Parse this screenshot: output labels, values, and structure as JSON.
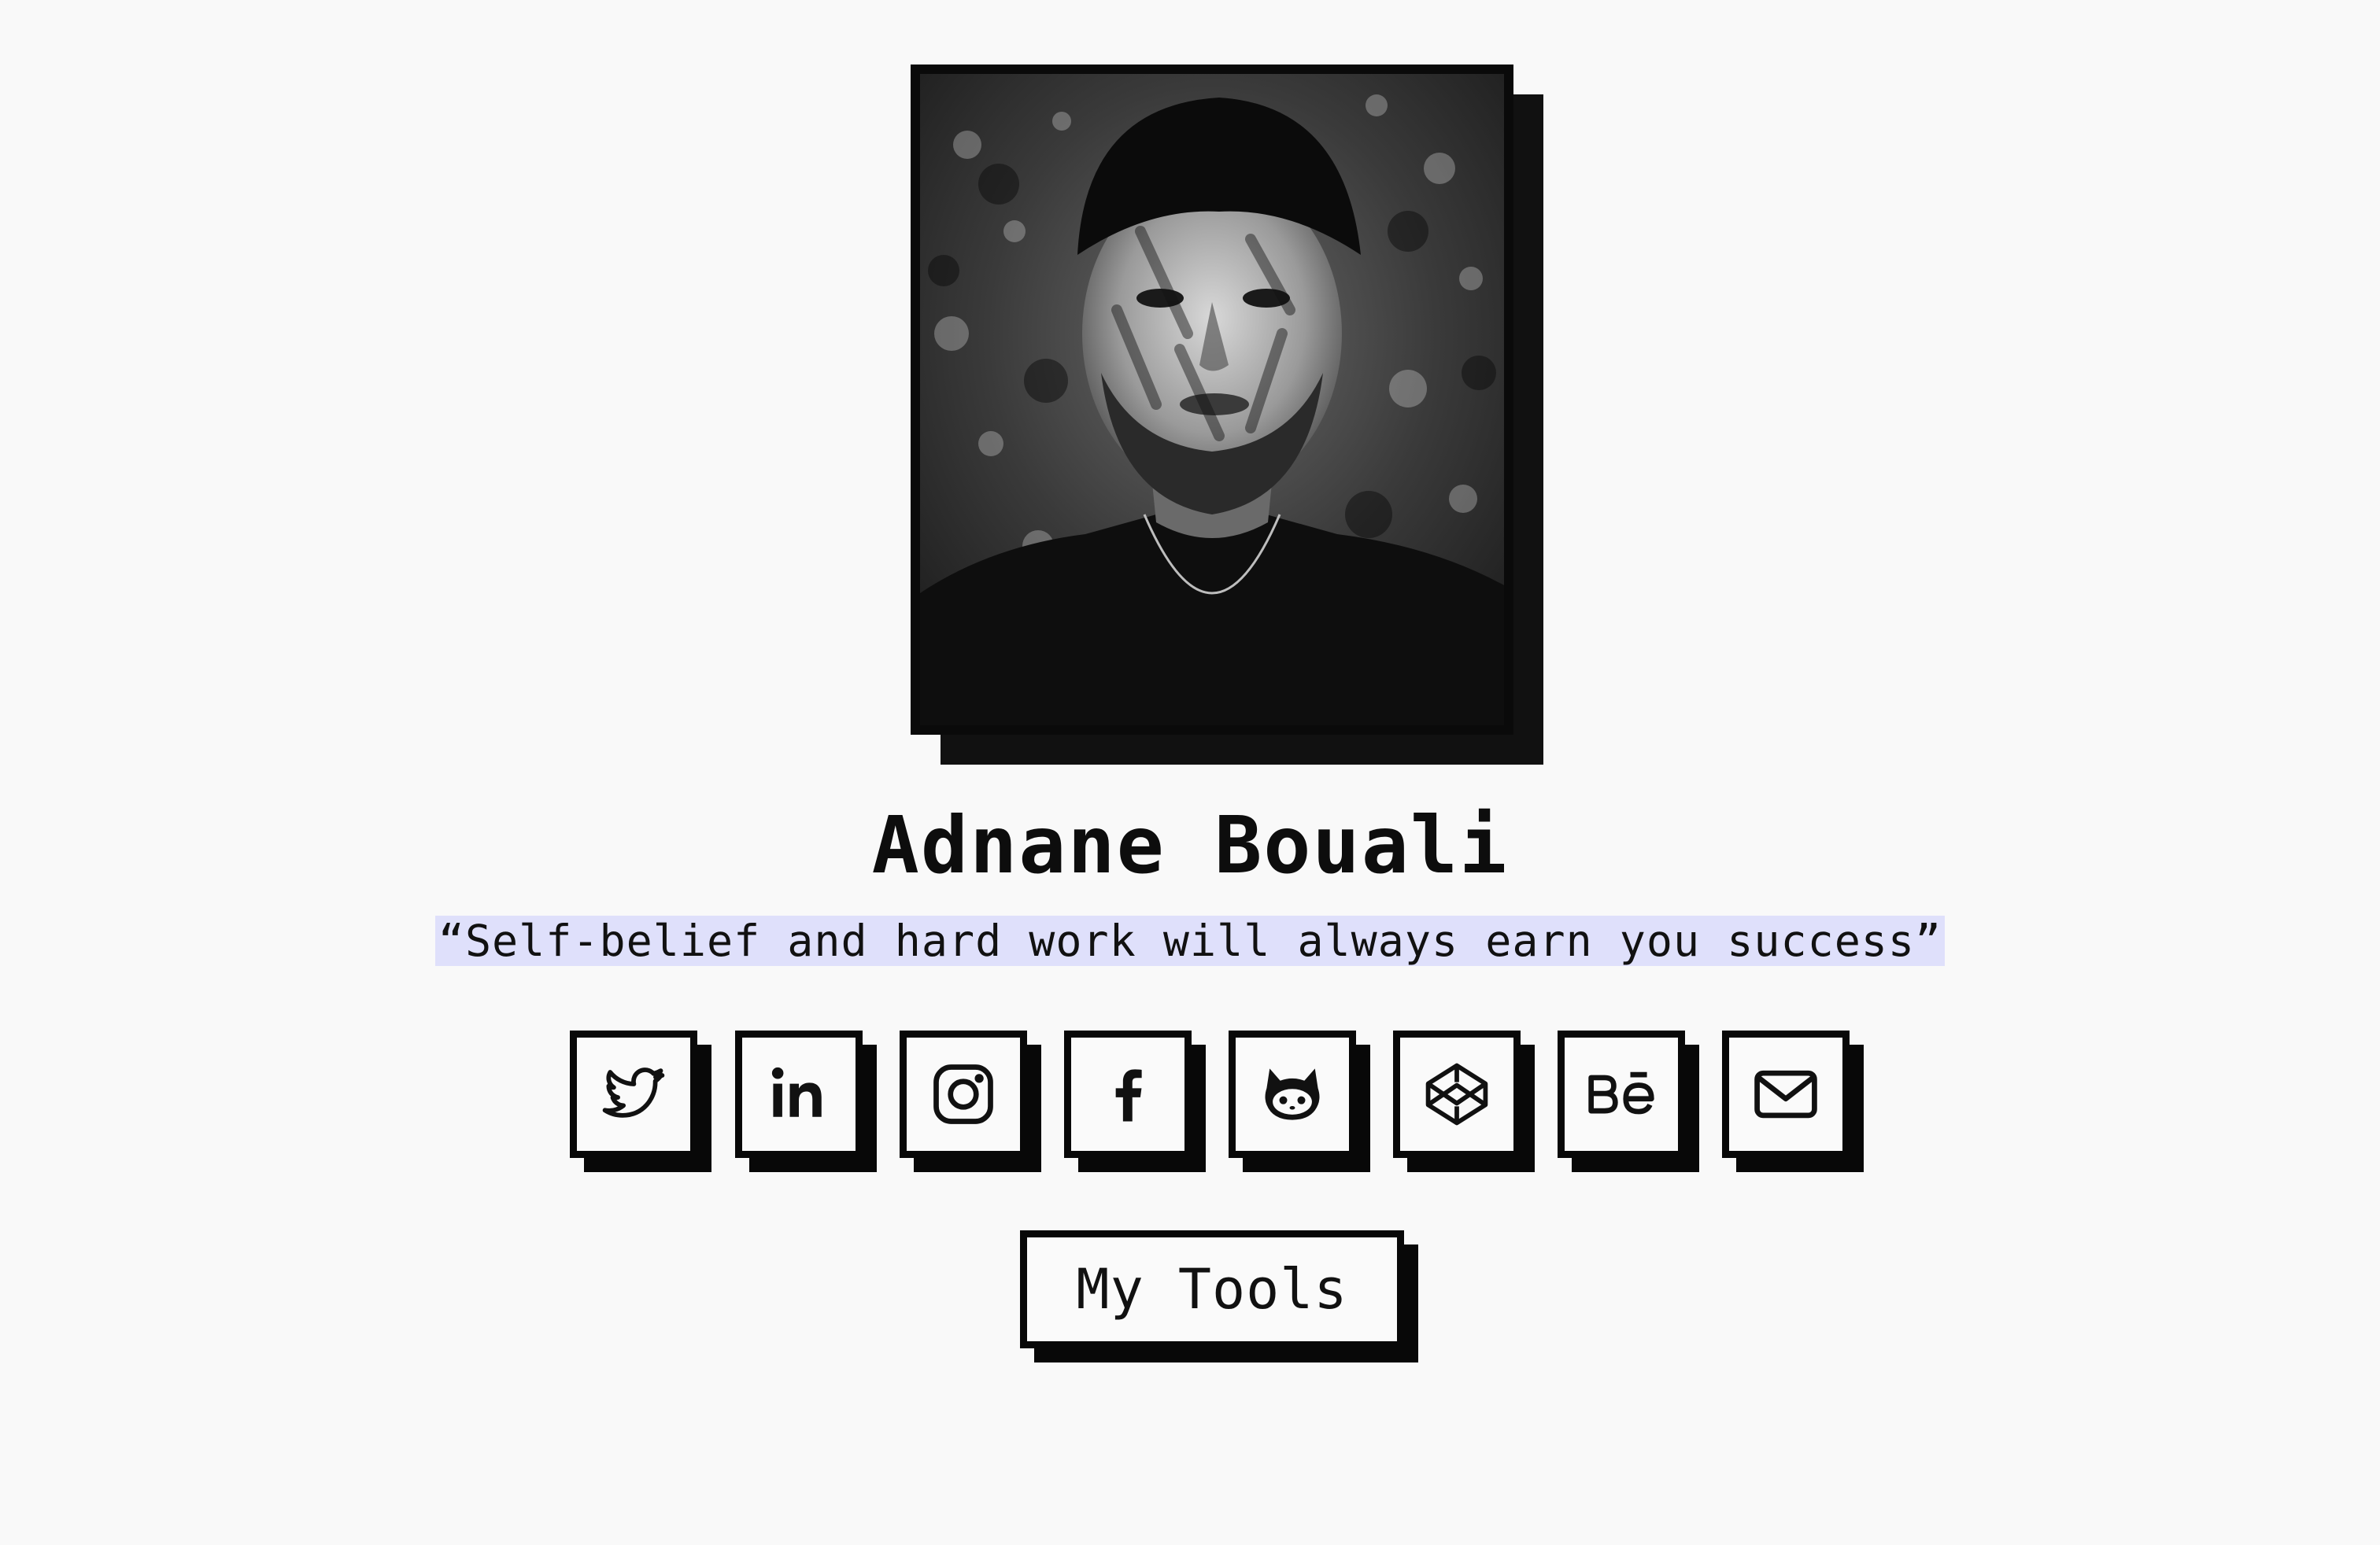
{
  "profile": {
    "name": "Adnane Bouali",
    "quote": "“Self-belief and hard work will always earn you success”",
    "photo": "portrait-photo"
  },
  "socials": [
    {
      "name": "twitter",
      "icon": "twitter-icon"
    },
    {
      "name": "linkedin",
      "icon": "linkedin-icon"
    },
    {
      "name": "instagram",
      "icon": "instagram-icon"
    },
    {
      "name": "facebook",
      "icon": "facebook-icon"
    },
    {
      "name": "github",
      "icon": "github-icon"
    },
    {
      "name": "codepen",
      "icon": "codepen-icon"
    },
    {
      "name": "behance",
      "icon": "behance-icon"
    },
    {
      "name": "email",
      "icon": "mail-icon"
    }
  ],
  "actions": {
    "tools_label": "My Tools"
  },
  "colors": {
    "background": "#f9f9f9",
    "ink": "#080808",
    "quote_highlight": "#dfe0fb"
  }
}
